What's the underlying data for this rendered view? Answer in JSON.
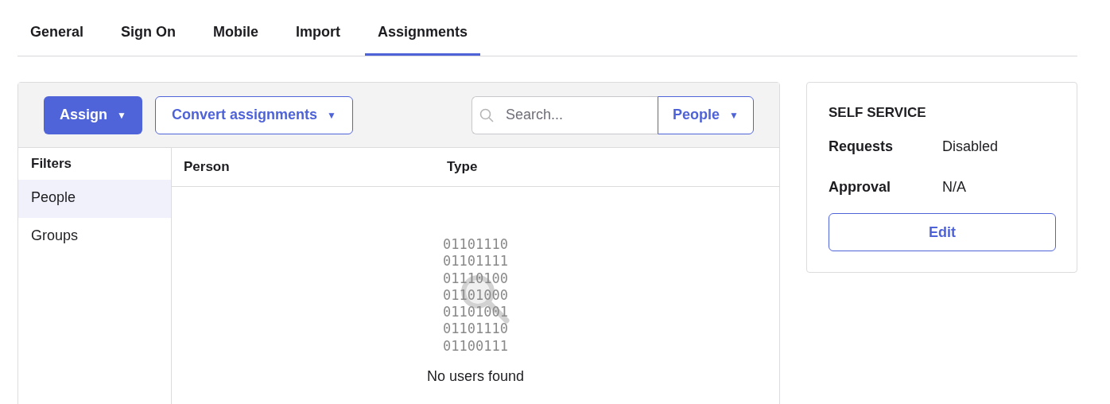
{
  "tabs": [
    {
      "label": "General",
      "selected": false
    },
    {
      "label": "Sign On",
      "selected": false
    },
    {
      "label": "Mobile",
      "selected": false
    },
    {
      "label": "Import",
      "selected": false
    },
    {
      "label": "Assignments",
      "selected": true
    }
  ],
  "toolbar": {
    "assign_button": {
      "label": "Assign",
      "caret": "▼"
    },
    "convert_button": {
      "label": "Convert assignments",
      "caret": "▼"
    },
    "search": {
      "placeholder": "Search..."
    },
    "scope_dropdown": {
      "label": "People",
      "caret": "▼"
    }
  },
  "filters": {
    "title": "Filters",
    "items": [
      {
        "label": "People",
        "selected": true
      },
      {
        "label": "Groups",
        "selected": false
      }
    ]
  },
  "table": {
    "columns": [
      "Person",
      "Type"
    ]
  },
  "empty_state": {
    "binary_lines": [
      "01101110",
      "01101111",
      "01110100",
      "01101000",
      "01101001",
      "01101110",
      "01100111"
    ],
    "message": "No users found"
  },
  "self_service": {
    "title": "SELF SERVICE",
    "rows": [
      {
        "label": "Requests",
        "value": "Disabled"
      },
      {
        "label": "Approval",
        "value": "N/A"
      }
    ],
    "edit_button": "Edit"
  }
}
